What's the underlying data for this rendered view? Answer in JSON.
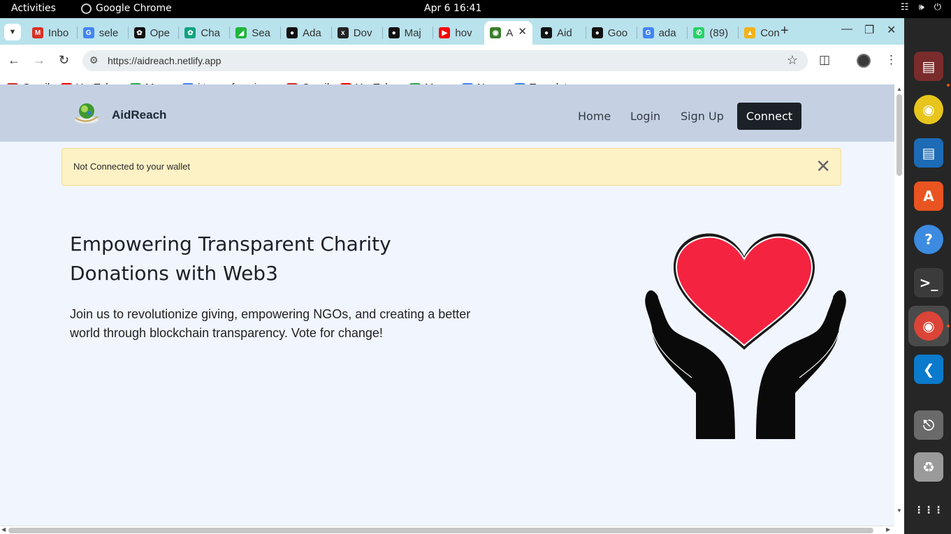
{
  "system_bar": {
    "activities": "Activities",
    "app_name": "Google Chrome",
    "clock": "Apr 6  16:41"
  },
  "browser": {
    "tabs": [
      {
        "label": "Inbo",
        "icon": "gmail-icon",
        "color": "#d93025"
      },
      {
        "label": "sele",
        "icon": "google-icon",
        "color": "#4285f4"
      },
      {
        "label": "Ope",
        "icon": "openai-icon",
        "color": "#111111"
      },
      {
        "label": "Cha",
        "icon": "chatgpt-icon",
        "color": "#10a37f"
      },
      {
        "label": "Sea",
        "icon": "tanzania-flag-icon",
        "color": "#1eb53a"
      },
      {
        "label": "Ada",
        "icon": "github-icon",
        "color": "#111111"
      },
      {
        "label": "Dov",
        "icon": "xfs-icon",
        "color": "#222222"
      },
      {
        "label": "Maj",
        "icon": "github-icon",
        "color": "#111111"
      },
      {
        "label": "hov",
        "icon": "youtube-icon",
        "color": "#ff0000"
      },
      {
        "label": "A",
        "icon": "aidreach-icon",
        "color": "#3a7d2c",
        "active": true
      },
      {
        "label": "Aid",
        "icon": "github-icon",
        "color": "#111111"
      },
      {
        "label": "Goo",
        "icon": "github-icon",
        "color": "#111111"
      },
      {
        "label": "ada",
        "icon": "google-icon",
        "color": "#4285f4"
      },
      {
        "label": "(89)",
        "icon": "whatsapp-icon",
        "color": "#25d366"
      },
      {
        "label": "Con",
        "icon": "praying-hands-icon",
        "color": "#f2b21a"
      }
    ],
    "url": "https://aidreach.netlify.app",
    "bookmarks": [
      {
        "label": "Gmail",
        "icon": "gmail-icon",
        "color": "#d93025"
      },
      {
        "label": "YouTube",
        "icon": "youtube-icon",
        "color": "#ff0000"
      },
      {
        "label": "Maps",
        "icon": "maps-icon",
        "color": "#34a853"
      },
      {
        "label": "i tunes for win...",
        "icon": "google-icon",
        "color": "#4285f4"
      },
      {
        "label": "Gmail",
        "icon": "gmail-icon",
        "color": "#d93025"
      },
      {
        "label": "YouTube",
        "icon": "youtube-icon",
        "color": "#ff0000"
      },
      {
        "label": "Maps",
        "icon": "maps-icon",
        "color": "#34a853"
      },
      {
        "label": "News",
        "icon": "news-icon",
        "color": "#4285f4"
      },
      {
        "label": "Translate",
        "icon": "translate-icon",
        "color": "#4285f4"
      }
    ]
  },
  "site": {
    "brand": "AidReach",
    "nav": {
      "home": "Home",
      "login": "Login",
      "signup": "Sign Up",
      "connect": "Connect"
    },
    "alert": "Not Connected to your wallet",
    "headline": "Empowering Transparent Charity Donations with Web3",
    "subcopy": "Join us to revolutionize giving, empowering NGOs, and creating a better world through blockchain transparency. Vote for change!",
    "colors": {
      "nav_bg": "#c5d1e3",
      "page_bg": "#f1f5fe",
      "alert_bg": "#fdf1c6",
      "heart": "#f42441"
    }
  },
  "dock": [
    {
      "name": "files-icon",
      "color": "#7a2b2b"
    },
    {
      "name": "rhythmbox-icon",
      "color": "#e7c51c"
    },
    {
      "name": "libreoffice-writer-icon",
      "color": "#1d6bb5"
    },
    {
      "name": "app-center-icon",
      "color": "#e95420"
    },
    {
      "name": "help-icon",
      "color": "#3c8be0"
    },
    {
      "name": "terminal-icon",
      "color": "#3b3b3b"
    },
    {
      "name": "chrome-icon",
      "color": "#db4437"
    },
    {
      "name": "vscode-icon",
      "color": "#0a7acc"
    },
    {
      "name": "usb-drive-icon",
      "color": "#6a6a6a"
    },
    {
      "name": "trash-icon",
      "color": "#9a9a9a"
    },
    {
      "name": "show-apps-icon",
      "color": "#ffffff"
    }
  ]
}
